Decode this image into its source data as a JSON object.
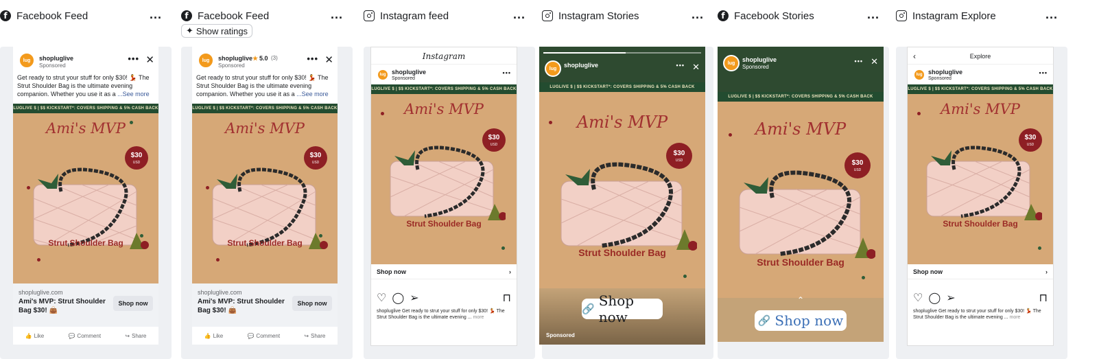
{
  "columns": [
    {
      "platform": "facebook",
      "title": "Facebook Feed",
      "more": "..."
    },
    {
      "platform": "facebook",
      "title": "Facebook Feed",
      "more": "...",
      "ratings_button": "Show ratings"
    },
    {
      "platform": "instagram",
      "title": "Instagram feed",
      "more": "..."
    },
    {
      "platform": "instagram",
      "title": "Instagram Stories",
      "more": "..."
    },
    {
      "platform": "facebook",
      "title": "Facebook Stories",
      "more": "..."
    },
    {
      "platform": "instagram",
      "title": "Instagram Explore",
      "more": "..."
    }
  ],
  "ad": {
    "brand": "shopluglive",
    "logo_text": "lug",
    "sponsored": "Sponsored",
    "rating": "5.0",
    "rating_count": "(3)",
    "caption_fb": "Get ready to strut your stuff for only $30! 💃 The Strut Shoulder Bag is the ultimate evening companion. Whether you use it as a",
    "see_more": "...See more",
    "banner": "LUGLIVE $ | $$ KICKSTART*: COVERS SHIPPING & 5% CASH BACK",
    "headline": "Ami's MVP",
    "price": "$30",
    "currency": "USD",
    "product": "Strut Shoulder Bag",
    "url": "shopluglive.com",
    "fb_title": "Ami's MVP: Strut Shoulder Bag $30! 👜",
    "cta": "Shop now",
    "like": "Like",
    "comment": "Comment",
    "share": "Share",
    "ig_logo": "Instagram",
    "ig_caption": "shopluglive Get ready to strut your stuff for only $30! 💃 The Strut Shoulder Bag is the ultimate evening ...",
    "ig_more": "more",
    "explore": "Explore",
    "sponsored_story": "Sponsored"
  },
  "colors": {
    "creative_bg": "#d6a877",
    "banner_bg": "#234c30",
    "headline": "#a13030",
    "price_bg": "#8e1f24",
    "story_green": "#2e4a30"
  }
}
